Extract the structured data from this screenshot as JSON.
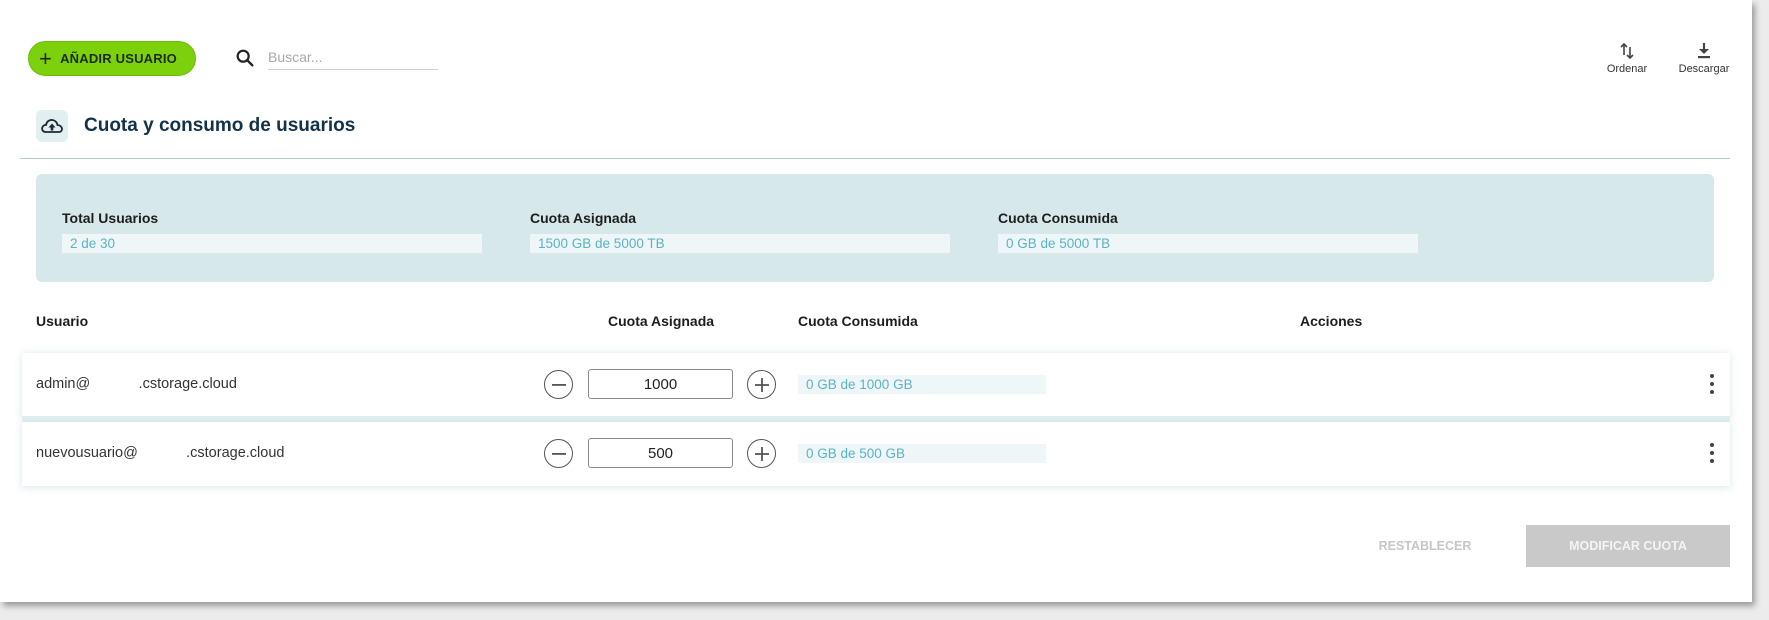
{
  "toolbar": {
    "add_user_label": "AÑADIR USUARIO",
    "search_placeholder": "Buscar...",
    "sort_label": "Ordenar",
    "download_label": "Descargar"
  },
  "section": {
    "title": "Cuota y consumo de usuarios"
  },
  "summary": {
    "total_users": {
      "label": "Total Usuarios",
      "value": "2 de 30"
    },
    "assigned_quota": {
      "label": "Cuota Asignada",
      "value": "1500 GB de 5000 TB"
    },
    "consumed_quota": {
      "label": "Cuota Consumida",
      "value": "0 GB de 5000 TB"
    }
  },
  "table": {
    "headers": {
      "user": "Usuario",
      "assigned": "Cuota Asignada",
      "consumed": "Cuota Consumida",
      "actions": "Acciones"
    },
    "rows": [
      {
        "email": "admin@            .cstorage.cloud",
        "quota": "1000",
        "consumed": "0 GB de 1000 GB"
      },
      {
        "email": "nuevousuario@            .cstorage.cloud",
        "quota": "500",
        "consumed": "0 GB de 500 GB"
      }
    ]
  },
  "footer": {
    "reset_label": "RESTABLECER",
    "modify_label": "MODIFICAR CUOTA"
  },
  "colors": {
    "accent_green": "#7dd10c",
    "summary_bg": "#d7e8ea",
    "value_text": "#5bb3c4",
    "title_text": "#12324a"
  },
  "icons": {
    "add": "plus-icon",
    "search": "search-icon",
    "sort": "sort-icon",
    "download": "download-icon",
    "section": "cloud-upload-icon",
    "decrement": "minus-circle-icon",
    "increment": "plus-circle-icon",
    "row_menu": "more-vertical-icon"
  }
}
